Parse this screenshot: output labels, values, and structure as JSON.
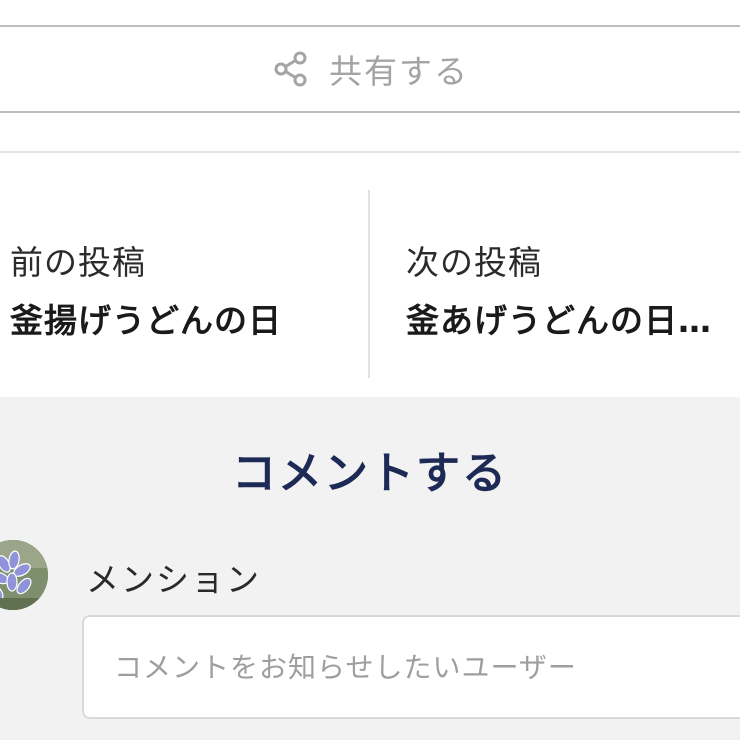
{
  "share": {
    "label": "共有する",
    "icon": "share-icon"
  },
  "post_nav": {
    "previous": {
      "kicker": "前の投稿",
      "title": "釜揚げうどんの日"
    },
    "next": {
      "kicker": "次の投稿",
      "title": "釜あげうどんの日…"
    }
  },
  "comments": {
    "heading": "コメントする",
    "mention": {
      "label": "メンション",
      "placeholder": "コメントをお知らせしたいユーザー",
      "value": ""
    },
    "avatar_icon": "user-avatar-flower"
  },
  "colors": {
    "heading": "#1d2a55",
    "muted_text": "#a4a4a4",
    "section_bg": "#f3f2f2",
    "border": "#bdbdbd"
  }
}
